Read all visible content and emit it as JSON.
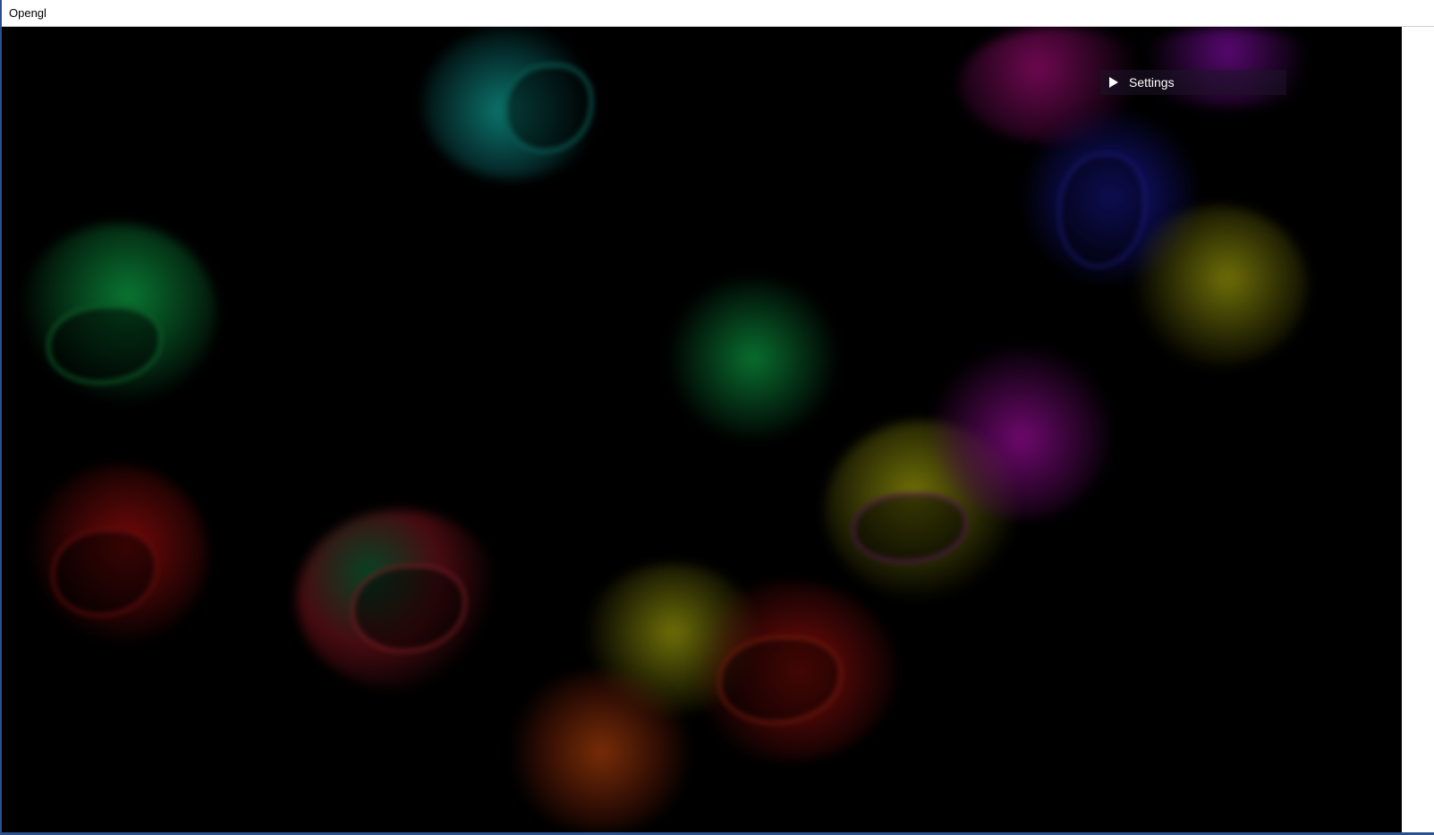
{
  "window": {
    "title": "Opengl"
  },
  "gui": {
    "settings_label": "Settings",
    "settings_icon": "triangle-right-icon"
  },
  "simulation": {
    "name": "fluid-dye-simulation",
    "splat_colors": [
      "#0e8a80",
      "#0b8a3a",
      "#8a0a0a",
      "#8a8a0a",
      "#8a0a8a",
      "#1a1aa0"
    ]
  }
}
